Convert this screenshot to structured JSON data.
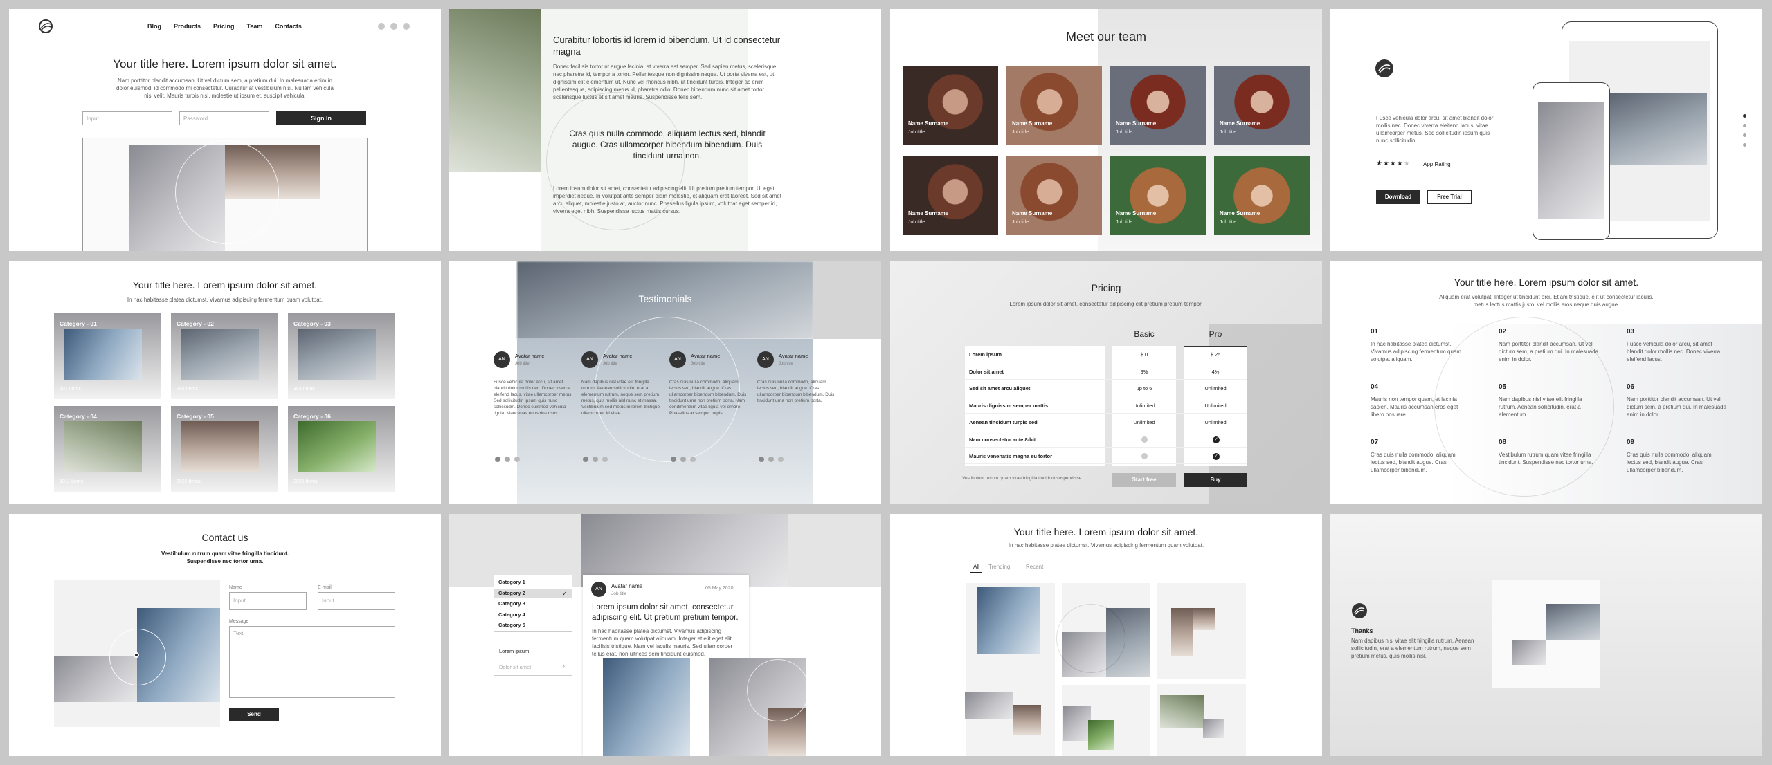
{
  "s1": {
    "nav": [
      "Blog",
      "Products",
      "Pricing",
      "Team",
      "Contacts"
    ],
    "title": "Your title here. Lorem ipsum dolor sit amet.",
    "body": "Nam porttitor blandit accumsan. Ut vel dictum sem, a pretium dui. In malesuada enim in dolor euismod, id commodo mi consectetur. Curabitur at vestibulum nisi. Nullam vehicula nisi velit. Mauris turpis nisl, molestie ut ipsum et, suscipit vehicula.",
    "input_ph": "Input",
    "password_ph": "Password",
    "signin": "Sign In"
  },
  "s2": {
    "head": "Curabitur lobortis id lorem id bibendum. Ut id consectetur magna",
    "p1": "Donec facilisis tortor ut augue lacinia, at viverra est semper. Sed sapien metus, scelerisque nec pharetra id, tempor a tortor. Pellentesque non dignissim neque. Ut porta viverra est, ut dignissim elit elementum ut. Nunc vel rhoncus nibh, ut tincidunt turpis. Integer ac enim pellentesque, adipiscing metus id, pharetra odio. Donec bibendum nunc sit amet tortor scelerisque luctus et sit amet mauris. Suspendisse felis sem.",
    "quote": "Cras quis nulla commodo, aliquam lectus sed, blandit augue. Cras ullamcorper bibendum bibendum. Duis tincidunt urna non.",
    "p2": "Lorem ipsum dolor sit amet, consectetur adipiscing elit. Ut pretium pretium tempor. Ut eget imperdiet neque. In volutpat ante semper diam molestie, et aliquam erat laoreet. Sed sit amet arcu aliquet, molestie justo at, auctor nunc. Phasellus ligula ipsum, volutpat eget semper id, viverra eget nibh. Suspendisse luctus mattis cursus."
  },
  "s3": {
    "title": "Meet our team",
    "name": "Name Surname",
    "job": "Job title"
  },
  "s4": {
    "text": "Fusce vehicula dolor arcu, sit amet blandit dolor mollis nec. Donec viverra eleifend lacus, vitae ullamcorper metus. Sed sollicitudin ipsum quis nunc sollicitudin.",
    "rating": "App Rating",
    "download": "Download",
    "trial": "Free Trial"
  },
  "s5": {
    "title": "Your title here. Lorem ipsum dolor sit amet.",
    "sub": "In hac habitasse platea dictumst. Vivamus adipiscing fermentum quam volutpat.",
    "cats": [
      {
        "name": "Category - 01",
        "items": "101 Items"
      },
      {
        "name": "Category - 02",
        "items": "202 Items"
      },
      {
        "name": "Category - 03",
        "items": "303 Items"
      },
      {
        "name": "Category - 04",
        "items": "1011 Items"
      },
      {
        "name": "Category - 05",
        "items": "2022 Items"
      },
      {
        "name": "Category - 06",
        "items": "3033 Items"
      }
    ]
  },
  "s6": {
    "title": "Testimonials",
    "initials": "AN",
    "name": "Avatar name",
    "job": "Job title",
    "texts": [
      "Fusce vehicula dolor arcu, sit amet blandit dolor mollis nec. Donec viverra eleifend lacus, vitae ullamcorper metus. Sed sollicitudin ipsum quis nunc sollicitudin. Donec euismod vehicula ligula. Maecenas eu varius risus",
      "Nam dapibus nisl vitae elit fringilla rutrum. Aenean sollicitudin, erat a elementum rutrum, neque sem pretium metus, quis mollis nisl nunc et massa. Vestibulum sed metus in lorem tristique ullamcorper id vitae.",
      "Cras quis nulla commodo, aliquam lectus sed, blandit augue. Cras ullamcorper bibendum bibendum. Duis tincidunt urna non pretium porta. Nam condimentum vitae ligula vel ornare. Phasellus at semper turpis.",
      "Cras quis nulla commodo, aliquam lectus sed, blandit augue. Cras ullamcorper bibendum bibendum. Duis tincidunt urna non pretium porta."
    ]
  },
  "s7": {
    "title": "Pricing",
    "sub": "Lorem ipsum dolor sit amet, consectetur adipiscing elit pretium pretium tempor.",
    "basic": "Basic",
    "pro": "Pro",
    "rows": [
      {
        "label": "Lorem ipsum",
        "basic": "$ 0",
        "pro": "$ 25"
      },
      {
        "label": "Dolor sit amet",
        "basic": "9%",
        "pro": "4%"
      },
      {
        "label": "Sed sit amet arcu aliquet",
        "basic": "up to 6",
        "pro": "Unlimited"
      },
      {
        "label": "Mauris dignissim semper mattis",
        "basic": "Unlimited",
        "pro": "Unlimited"
      },
      {
        "label": "Aenean tincidunt turpis sed",
        "basic": "Unlimited",
        "pro": "Unlimited"
      },
      {
        "label": "Nam consectetur ante 8-bit",
        "basic": "",
        "pro": ""
      },
      {
        "label": "Mauris venenatis magna eu tortor",
        "basic": "",
        "pro": ""
      }
    ],
    "note": "Vestibulum rutrum quam vitae fringilla tincidunt suspendisse.",
    "start": "Start free",
    "buy": "Buy"
  },
  "s8": {
    "title": "Your title here. Lorem ipsum dolor sit amet.",
    "sub": "Aliquam erat volutpat. Integer ut tincidunt orci. Etiam tristique, elit ut consectetur iaculis, metus lectus mattis justo, vel mollis eros neque quis augue.",
    "items": [
      {
        "n": "01",
        "t": "In hac habitasse platea dictumst. Vivamus adipiscing fermentum quam volutpat aliquam."
      },
      {
        "n": "02",
        "t": "Nam porttitor blandit accumsan. Ut vel dictum sem, a pretium dui. In malesuada enim in dolor."
      },
      {
        "n": "03",
        "t": "Fusce vehicula dolor arcu, sit amet blandit dolor mollis nec. Donec viverra eleifend lacus."
      },
      {
        "n": "04",
        "t": "Mauris non tempor quam, et lacinia sapien. Mauris accumsan eros eget libero posuere."
      },
      {
        "n": "05",
        "t": "Nam dapibus nisl vitae elit fringilla rutrum. Aenean sollicitudin, erat a elementum."
      },
      {
        "n": "06",
        "t": "Nam porttitor blandit accumsan. Ut vel dictum sem, a pretium dui. In malesuada enim in dolor."
      },
      {
        "n": "07",
        "t": "Cras quis nulla commodo, aliquam lectus sed, blandit augue. Cras ullamcorper bibendum."
      },
      {
        "n": "08",
        "t": "Vestibulum rutrum quam vitae fringilla tincidunt. Suspendisse nec tortor urna."
      },
      {
        "n": "09",
        "t": "Cras quis nulla commodo, aliquam lectus sed, blandit augue. Cras ullamcorper bibendum."
      }
    ]
  },
  "s9": {
    "title": "Contact us",
    "sub": "Vestibulum rutrum quam vitae fringilla tincidunt. Suspendisse nec tortor urna.",
    "name_label": "Name",
    "email_label": "E-mail",
    "input_ph": "Input",
    "msg_label": "Message",
    "text_ph": "Text",
    "send": "Send"
  },
  "s10": {
    "cats": [
      "Category 1",
      "Category 2",
      "Category 3",
      "Category 4",
      "Category 5"
    ],
    "list": [
      "Lorem ipsum",
      "Dolor sit amet"
    ],
    "initials": "AN",
    "name": "Avatar name",
    "job": "Job title",
    "date": "05 May 2020",
    "head": "Lorem ipsum dolor sit amet, consectetur adipiscing elit. Ut pretium pretium tempor.",
    "body": "In hac habitasse platea dictumst. Vivamus adipiscing fermentum quam volutpat aliquam. Integer et elit eget elit facilisis tristique. Nam vel iaculis mauris. Sed ullamcorper tellus erat, non ultrices sem tincidunt euismod."
  },
  "s11": {
    "title": "Your title here. Lorem ipsum dolor sit amet.",
    "sub": "In hac habitasse platea dictumst. Vivamus adipiscing fermentum quam volutpat.",
    "tabs": [
      "All",
      "Trending",
      "Recent"
    ]
  },
  "s12": {
    "head": "Thanks",
    "text": "Nam dapibus nisl vitae elit fringilla rutrum. Aenean sollicitudin, erat a elementum rutrum, neque sem pretium metus, quis mollis nisl."
  }
}
